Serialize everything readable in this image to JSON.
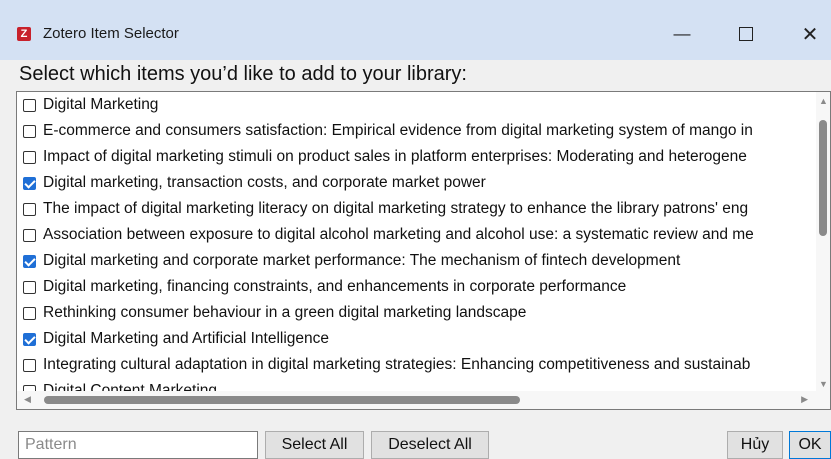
{
  "window": {
    "app_icon": "Z",
    "title": "Zotero Item Selector",
    "minimize_glyph": "—",
    "close_glyph": "✕"
  },
  "prompt": "Select which items you’d like to add to your library:",
  "items": [
    {
      "label": "Digital Marketing",
      "checked": false
    },
    {
      "label": "E-commerce and consumers satisfaction: Empirical evidence from digital marketing system of mango in",
      "checked": false
    },
    {
      "label": "Impact of digital marketing stimuli on product sales in platform enterprises: Moderating and heterogene",
      "checked": false
    },
    {
      "label": "Digital marketing, transaction costs, and corporate market power",
      "checked": true
    },
    {
      "label": "The impact of digital marketing literacy on digital marketing strategy to enhance the library patrons' eng",
      "checked": false
    },
    {
      "label": "Association between exposure to digital alcohol marketing and alcohol use: a systematic review and me",
      "checked": false
    },
    {
      "label": "Digital marketing and corporate market performance: The mechanism of fintech development",
      "checked": true
    },
    {
      "label": "Digital marketing, financing constraints, and enhancements in corporate performance",
      "checked": false
    },
    {
      "label": "Rethinking consumer behaviour in a green digital marketing landscape",
      "checked": false
    },
    {
      "label": "Digital Marketing and Artificial Intelligence",
      "checked": true
    },
    {
      "label": "Integrating cultural adaptation in digital marketing strategies: Enhancing competitiveness and sustainab",
      "checked": false
    },
    {
      "label": "Digital Content Marketing",
      "checked": false
    }
  ],
  "scroll": {
    "vertical_position": 0.1,
    "horizontal_position": 0.0
  },
  "footer": {
    "pattern_placeholder": "Pattern",
    "select_all": "Select All",
    "deselect_all": "Deselect All",
    "cancel": "Hủy",
    "ok": "OK"
  },
  "colors": {
    "titlebar": "#d4e1f3",
    "checkbox_checked": "#1f6fd6",
    "app_icon": "#c8212b"
  }
}
